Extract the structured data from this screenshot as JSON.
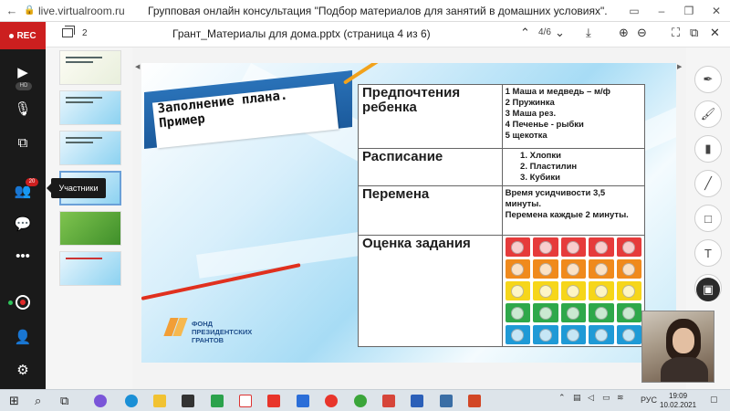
{
  "browser": {
    "url": "live.virtualroom.ru",
    "tab_title": "Групповая онлайн консультация \"Подбор материалов для занятий в домашних условиях\"."
  },
  "sidebar": {
    "rec_label": "REC",
    "camera_badge": "HD",
    "participants_count": "20",
    "participants_tooltip": "Участники"
  },
  "document": {
    "page_count": "2",
    "name": "Грант_Материалы для дома.pptx (страница 4 из 6)",
    "page_indicator": "4/6"
  },
  "slide": {
    "title": "Заполнение плана. Пример",
    "logo_text": [
      "ФОНД",
      "ПРЕЗИДЕНТСКИХ",
      "ГРАНТОВ"
    ],
    "table": {
      "rows": [
        {
          "label": "Предпочтения ребенка",
          "lines": [
            "1 Маша и медведь – м/ф",
            "2 Пружинка",
            "3 Маша рез.",
            "4 Печенье - рыбки",
            "5 щекотка"
          ]
        },
        {
          "label": "Расписание",
          "list": [
            "Хлопки",
            "Пластилин",
            "Кубики"
          ]
        },
        {
          "label": "Перемена",
          "lines": [
            "Время усидчивости 3,5 минуты.",
            "Перемена каждые 2 минуты."
          ]
        },
        {
          "label": "Оценка задания"
        }
      ]
    },
    "sticker_row_colors": [
      "#e63b3b",
      "#f08a1c",
      "#f6d61a",
      "#2ea84a",
      "#1f9ad6"
    ]
  },
  "taskbar": {
    "language": "РУС",
    "time": "19:09",
    "date": "10.02.2021"
  }
}
